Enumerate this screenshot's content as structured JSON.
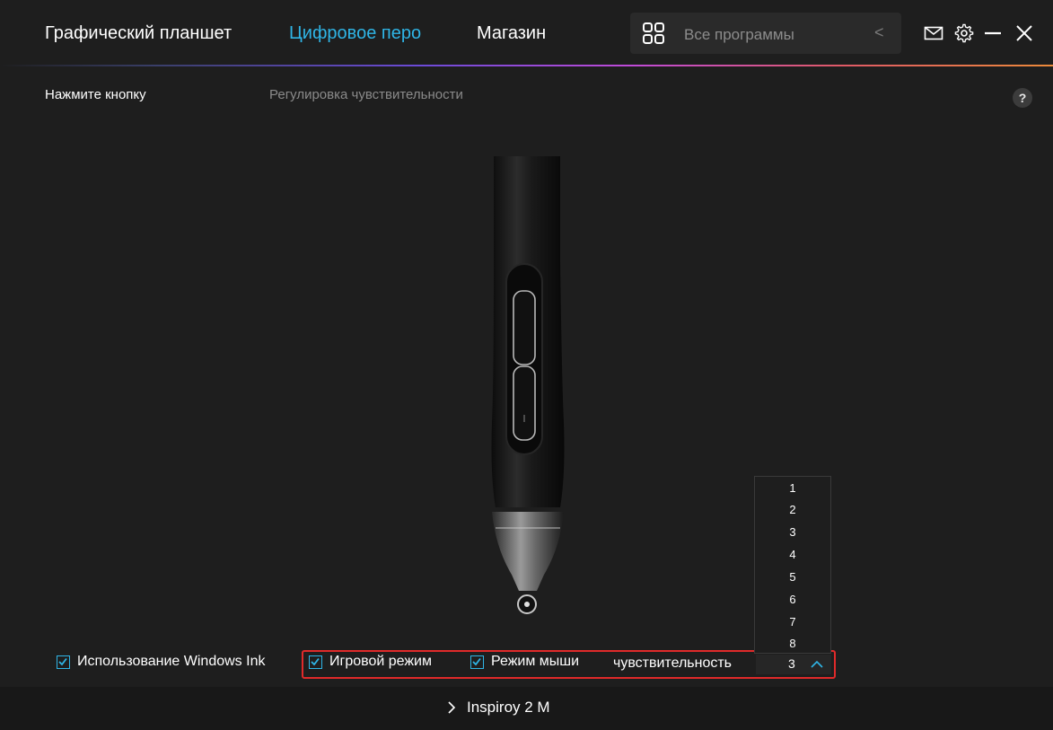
{
  "nav": {
    "tabs": [
      {
        "label": "Графический планшет",
        "active": false
      },
      {
        "label": "Цифровое перо",
        "active": true
      },
      {
        "label": "Магазин",
        "active": false
      }
    ],
    "app_search": {
      "icon": "grid-icon",
      "label": "Все программы",
      "back_icon": "chevron-left-icon",
      "back_glyph": "<"
    },
    "window_icons": [
      "mail-icon",
      "gear-icon",
      "minimize-icon",
      "close-icon"
    ]
  },
  "subtabs": [
    {
      "label": "Нажмите кнопку",
      "active": true
    },
    {
      "label": "Регулировка чувствительности",
      "active": false
    }
  ],
  "help": {
    "label": "?"
  },
  "options": {
    "windows_ink": {
      "label": "Использование Windows Ink",
      "checked": true
    },
    "game_mode": {
      "label": "Игровой режим",
      "checked": true
    },
    "mouse_mode": {
      "label": "Режим мыши",
      "checked": true
    },
    "sensitivity_label": "чувствительность"
  },
  "sensitivity_dropdown": {
    "selected": "3",
    "options": [
      "1",
      "2",
      "3",
      "4",
      "5",
      "6",
      "7",
      "8"
    ]
  },
  "footer": {
    "device": "Inspiroy 2 M",
    "chevron": "chevron-right-icon"
  },
  "colors": {
    "accent": "#2fb5e6",
    "highlight": "#e02a2a",
    "background": "#1e1e1e"
  }
}
